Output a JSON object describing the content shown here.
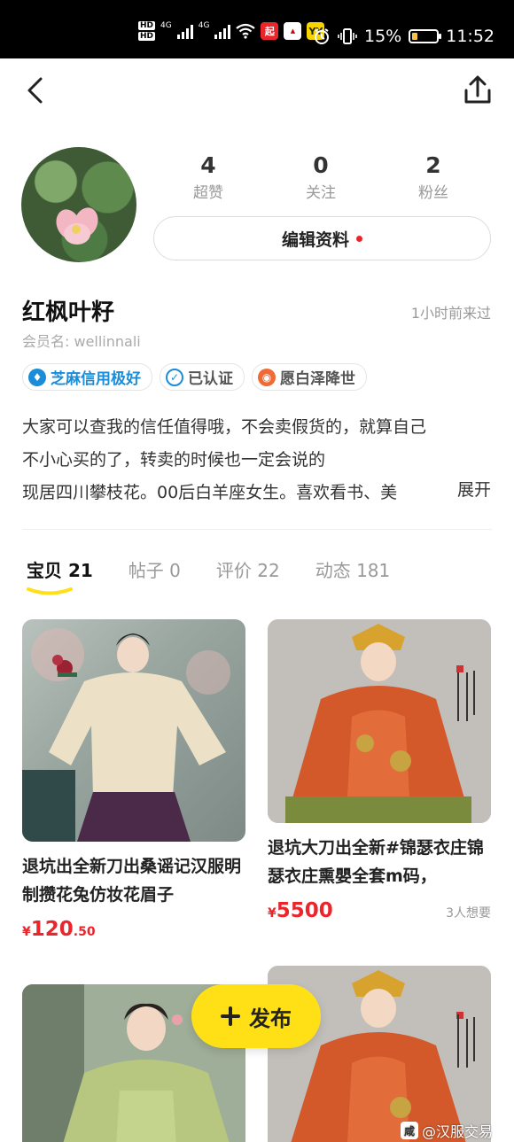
{
  "status_bar": {
    "hd1": "HD",
    "hd2": "HD",
    "net1": "4G",
    "net2": "4G",
    "app1_icon": "qi-app-icon",
    "app1_text": "起",
    "app2_icon": "huawei-icon",
    "app3_icon": "yy-icon",
    "app3_text": "YY",
    "battery": "15%",
    "time": "11:52"
  },
  "nav": {
    "back_icon": "back-arrow-icon",
    "share_icon": "share-icon"
  },
  "profile": {
    "stats": [
      {
        "value": "4",
        "label": "超赞"
      },
      {
        "value": "0",
        "label": "关注"
      },
      {
        "value": "2",
        "label": "粉丝"
      }
    ],
    "edit_label": "编辑资料",
    "name": "红枫叶籽",
    "last_seen": "1小时前来过",
    "member_name": "会员名: wellinnali",
    "tags": [
      {
        "icon": "zhima-credit-icon",
        "glyph": "♦",
        "label": "芝麻信用极好",
        "color": "#1a8cd8"
      },
      {
        "icon": "verified-icon",
        "glyph": "✓",
        "label": "已认证",
        "color": "#555"
      },
      {
        "icon": "weibo-icon",
        "glyph": "◉",
        "label": "愿白泽降世",
        "color": "#555"
      }
    ],
    "bio_lines": [
      "大家可以查我的信任值得哦，不会卖假货的，就算自己",
      "不小心买的了，转卖的时候也一定会说的",
      "现居四川攀枝花。00后白羊座女生。喜欢看书、美"
    ],
    "expand_label": "展开"
  },
  "tabs": [
    {
      "label": "宝贝",
      "count": "21",
      "active": true
    },
    {
      "label": "帖子",
      "count": "0"
    },
    {
      "label": "评价",
      "count": "22"
    },
    {
      "label": "动态",
      "count": "181"
    }
  ],
  "items": [
    {
      "title": "退坑出全新刀出桑谣记汉服明制攒花兔仿妆花眉子",
      "currency": "¥",
      "price_main": "120",
      "price_dec": ".50",
      "wants": ""
    },
    {
      "title": "退坑大刀出全新#锦瑟衣庄锦瑟衣庄熏嬰全套m码，",
      "currency": "¥",
      "price_main": "5500",
      "price_dec": "",
      "wants": "3人想要"
    }
  ],
  "publish_label": "发布",
  "watermark": "@汉服交易",
  "watermark_glyph": "咸"
}
